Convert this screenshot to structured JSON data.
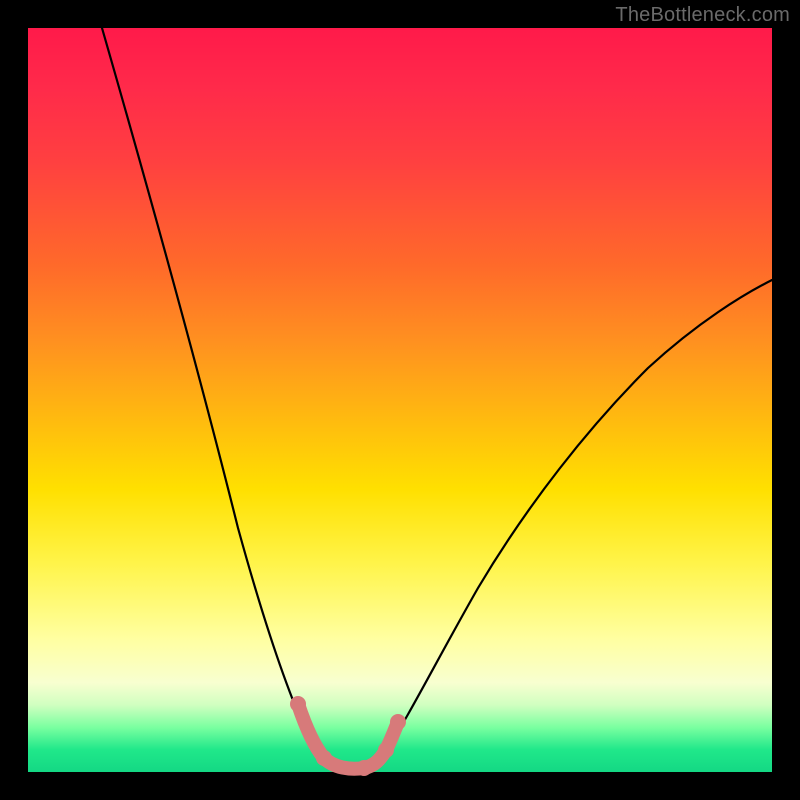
{
  "watermark": "TheBottleneck.com",
  "chart_data": {
    "type": "line",
    "title": "",
    "xlabel": "",
    "ylabel": "",
    "xlim": [
      0,
      100
    ],
    "ylim": [
      0,
      100
    ],
    "background_gradient": {
      "top": "#ff1a4a",
      "bottom": "#14d884",
      "meaning": "red high → green low (bottleneck severity)"
    },
    "series": [
      {
        "name": "bottleneck-curve",
        "x": [
          10,
          14,
          18,
          22,
          26,
          30,
          32,
          34,
          36,
          38,
          40,
          42,
          44,
          48,
          52,
          56,
          60,
          66,
          72,
          78,
          84,
          90,
          96,
          100
        ],
        "values": [
          100,
          88,
          76,
          64,
          52,
          38,
          30,
          20,
          10,
          4,
          2,
          2,
          4,
          10,
          18,
          26,
          32,
          40,
          46,
          52,
          56,
          60,
          63,
          65
        ]
      }
    ],
    "highlight_segment": {
      "name": "optimal-range",
      "color": "#d77a7a",
      "x": [
        34,
        36,
        38,
        40,
        42,
        44,
        46
      ],
      "values": [
        14,
        6,
        3,
        2,
        2,
        3,
        8
      ]
    }
  }
}
